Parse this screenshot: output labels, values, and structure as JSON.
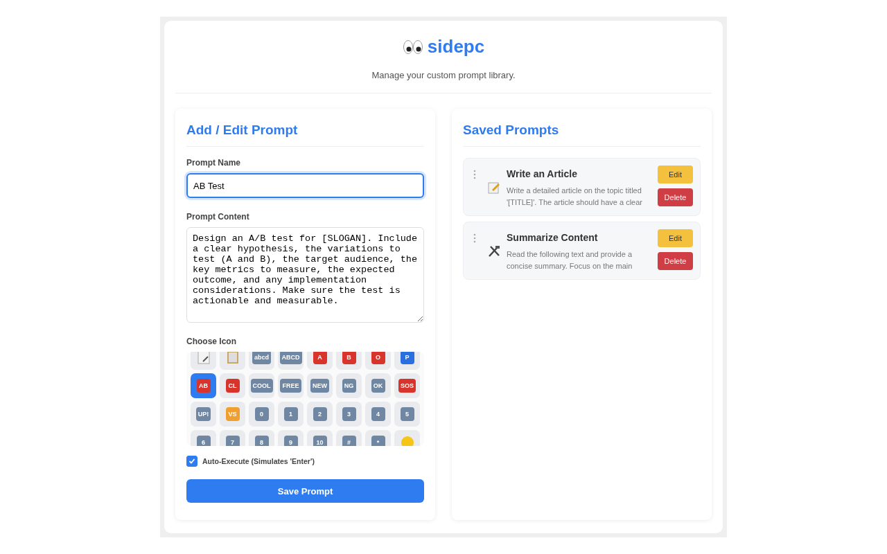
{
  "header": {
    "title": "sidepc",
    "subtitle": "Manage your custom prompt library."
  },
  "editor": {
    "heading": "Add / Edit Prompt",
    "name_label": "Prompt Name",
    "name_value": "AB Test",
    "content_label": "Prompt Content",
    "content_value": "Design an A/B test for [SLOGAN]. Include a clear hypothesis, the variations to test (A and B), the target audience, the key metrics to measure, the expected outcome, and any implementation considerations. Make sure the test is actionable and measurable.",
    "icon_label": "Choose Icon",
    "icons": [
      {
        "kind": "memo",
        "selected": false
      },
      {
        "kind": "clipboard",
        "selected": false
      },
      {
        "kind": "key",
        "label": "abcd",
        "color": "#6f87a3",
        "selected": false
      },
      {
        "kind": "key",
        "label": "ABCD",
        "color": "#6f87a3",
        "selected": false
      },
      {
        "kind": "key",
        "label": "A",
        "color": "#d9342b",
        "selected": false
      },
      {
        "kind": "key",
        "label": "B",
        "color": "#d9342b",
        "selected": false
      },
      {
        "kind": "key",
        "label": "O",
        "color": "#d9342b",
        "selected": false
      },
      {
        "kind": "key",
        "label": "P",
        "color": "#2a6fe0",
        "selected": false
      },
      {
        "kind": "key",
        "label": "AB",
        "color": "#d9342b",
        "selected": true
      },
      {
        "kind": "key",
        "label": "CL",
        "color": "#d9342b",
        "selected": false
      },
      {
        "kind": "key",
        "label": "COOL",
        "color": "#6f87a3",
        "selected": false
      },
      {
        "kind": "key",
        "label": "FREE",
        "color": "#6f87a3",
        "selected": false
      },
      {
        "kind": "key",
        "label": "NEW",
        "color": "#6f87a3",
        "selected": false
      },
      {
        "kind": "key",
        "label": "NG",
        "color": "#6f87a3",
        "selected": false
      },
      {
        "kind": "key",
        "label": "OK",
        "color": "#6f87a3",
        "selected": false
      },
      {
        "kind": "key",
        "label": "SOS",
        "color": "#d9342b",
        "selected": false
      },
      {
        "kind": "key",
        "label": "UP!",
        "color": "#6f87a3",
        "selected": false
      },
      {
        "kind": "key",
        "label": "VS",
        "color": "#f0a030",
        "selected": false
      },
      {
        "kind": "key",
        "label": "0",
        "color": "#6f87a3",
        "selected": false
      },
      {
        "kind": "key",
        "label": "1",
        "color": "#6f87a3",
        "selected": false
      },
      {
        "kind": "key",
        "label": "2",
        "color": "#6f87a3",
        "selected": false
      },
      {
        "kind": "key",
        "label": "3",
        "color": "#6f87a3",
        "selected": false
      },
      {
        "kind": "key",
        "label": "4",
        "color": "#6f87a3",
        "selected": false
      },
      {
        "kind": "key",
        "label": "5",
        "color": "#6f87a3",
        "selected": false
      },
      {
        "kind": "key",
        "label": "6",
        "color": "#6f87a3",
        "selected": false
      },
      {
        "kind": "key",
        "label": "7",
        "color": "#6f87a3",
        "selected": false
      },
      {
        "kind": "key",
        "label": "8",
        "color": "#6f87a3",
        "selected": false
      },
      {
        "kind": "key",
        "label": "9",
        "color": "#6f87a3",
        "selected": false
      },
      {
        "kind": "key",
        "label": "10",
        "color": "#6f87a3",
        "selected": false
      },
      {
        "kind": "key",
        "label": "#",
        "color": "#6f87a3",
        "selected": false
      },
      {
        "kind": "key",
        "label": "*",
        "color": "#6f87a3",
        "selected": false
      },
      {
        "kind": "face",
        "selected": false
      }
    ],
    "auto_execute": {
      "label": "Auto-Execute (Simulates 'Enter')",
      "checked": true
    },
    "save_button": "Save Prompt"
  },
  "saved": {
    "heading": "Saved Prompts",
    "prompts": [
      {
        "kind": "memo",
        "title": "Write an Article",
        "text": "Write a detailed article on the topic titled '[TITLE]'. The article should have a clear",
        "edit": "Edit",
        "delete": "Delete"
      },
      {
        "kind": "tools",
        "title": "Summarize Content",
        "text": "Read the following text and provide a concise summary. Focus on the main",
        "edit": "Edit",
        "delete": "Delete"
      }
    ]
  }
}
